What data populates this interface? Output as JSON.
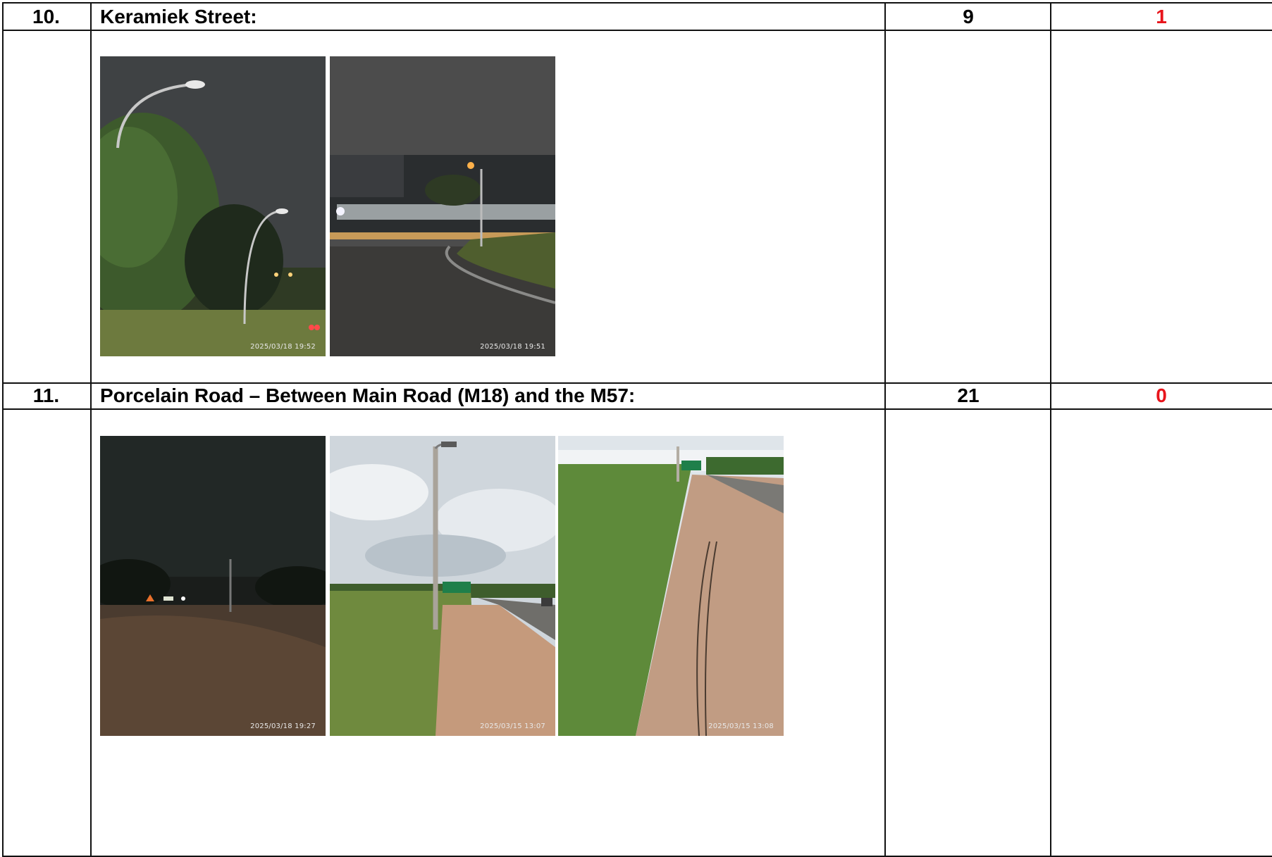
{
  "rows": [
    {
      "number": "10.",
      "title": "Keramiek Street:",
      "count": "9",
      "faulty": "1",
      "photos": [
        {
          "timestamp": "2025/03/18 19:52",
          "scene": "night-streetlights-trees"
        },
        {
          "timestamp": "2025/03/18 19:51",
          "scene": "night-factory-road"
        }
      ]
    },
    {
      "number": "11.",
      "title": "Porcelain Road – Between Main Road (M18) and the M57:",
      "count": "21",
      "faulty": "0",
      "photos": [
        {
          "timestamp": "2025/03/18 19:27",
          "scene": "night-dark-road"
        },
        {
          "timestamp": "2025/03/15 13:07",
          "scene": "day-pole-grass-road"
        },
        {
          "timestamp": "2025/03/15 13:08",
          "scene": "day-dirt-path-grass"
        }
      ]
    }
  ],
  "colors": {
    "border": "#111111",
    "faulty_text": "#e8141b"
  }
}
